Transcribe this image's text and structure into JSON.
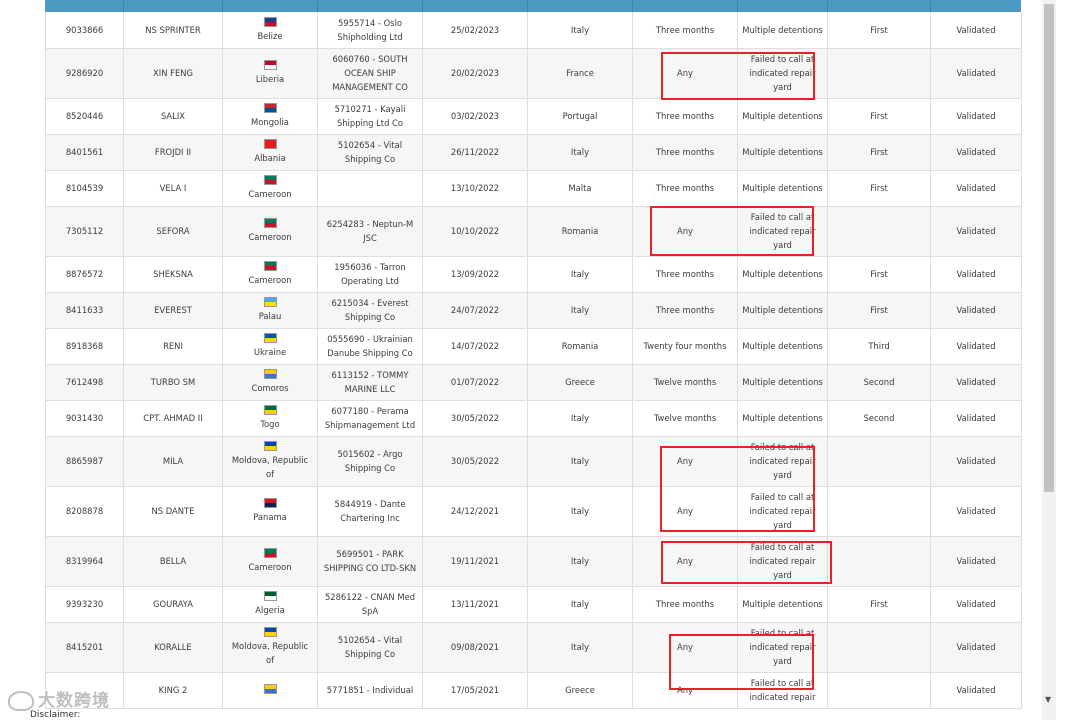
{
  "rows": [
    {
      "imo": "9033866",
      "name": "NS SPRINTER",
      "flag": "Belize",
      "flag_colors": [
        "#1c3f94",
        "#c8102e"
      ],
      "company": "5955714 - Oslo Shipholding Ltd",
      "date": "25/02/2023",
      "location": "Italy",
      "duration": "Three months",
      "reason": "Multiple detentions",
      "level": "First",
      "status": "Validated"
    },
    {
      "imo": "9286920",
      "name": "XIN FENG",
      "flag": "Liberia",
      "flag_colors": [
        "#bf0a30",
        "#ffffff"
      ],
      "company": "6060760 - SOUTH OCEAN SHIP MANAGEMENT CO",
      "date": "20/02/2023",
      "location": "France",
      "duration": "Any",
      "reason": "Failed to call at indicated repair yard",
      "level": "",
      "status": "Validated"
    },
    {
      "imo": "8520446",
      "name": "SALIX",
      "flag": "Mongolia",
      "flag_colors": [
        "#c4272f",
        "#015197"
      ],
      "company": "5710271 - Kayali Shipping Ltd Co",
      "date": "03/02/2023",
      "location": "Portugal",
      "duration": "Three months",
      "reason": "Multiple detentions",
      "level": "First",
      "status": "Validated"
    },
    {
      "imo": "8401561",
      "name": "FROJDI II",
      "flag": "Albania",
      "flag_colors": [
        "#e41e20",
        "#e41e20"
      ],
      "company": "5102654 - Vital Shipping Co",
      "date": "26/11/2022",
      "location": "Italy",
      "duration": "Three months",
      "reason": "Multiple detentions",
      "level": "First",
      "status": "Validated"
    },
    {
      "imo": "8104539",
      "name": "VELA I",
      "flag": "Cameroon",
      "flag_colors": [
        "#007a5e",
        "#ce1126"
      ],
      "company": "",
      "date": "13/10/2022",
      "location": "Malta",
      "duration": "Three months",
      "reason": "Multiple detentions",
      "level": "First",
      "status": "Validated"
    },
    {
      "imo": "7305112",
      "name": "SEFORA",
      "flag": "Cameroon",
      "flag_colors": [
        "#007a5e",
        "#ce1126"
      ],
      "company": "6254283 - Neptun-M JSC",
      "date": "10/10/2022",
      "location": "Romania",
      "duration": "Any",
      "reason": "Failed to call at indicated repair yard",
      "level": "",
      "status": "Validated"
    },
    {
      "imo": "8876572",
      "name": "SHEKSNA",
      "flag": "Cameroon",
      "flag_colors": [
        "#007a5e",
        "#ce1126"
      ],
      "company": "1956036 - Tarron Operating Ltd",
      "date": "13/09/2022",
      "location": "Italy",
      "duration": "Three months",
      "reason": "Multiple detentions",
      "level": "First",
      "status": "Validated"
    },
    {
      "imo": "8411633",
      "name": "EVEREST",
      "flag": "Palau",
      "flag_colors": [
        "#4aadd6",
        "#ffde00"
      ],
      "company": "6215034 - Everest Shipping Co",
      "date": "24/07/2022",
      "location": "Italy",
      "duration": "Three months",
      "reason": "Multiple detentions",
      "level": "First",
      "status": "Validated"
    },
    {
      "imo": "8918368",
      "name": "RENI",
      "flag": "Ukraine",
      "flag_colors": [
        "#0057b7",
        "#ffd700"
      ],
      "company": "0555690 - Ukrainian Danube Shipping Co",
      "date": "14/07/2022",
      "location": "Romania",
      "duration": "Twenty four months",
      "reason": "Multiple detentions",
      "level": "Third",
      "status": "Validated"
    },
    {
      "imo": "7612498",
      "name": "TURBO SM",
      "flag": "Comoros",
      "flag_colors": [
        "#ffc61e",
        "#3a75c4"
      ],
      "company": "6113152 - TOMMY MARINE LLC",
      "date": "01/07/2022",
      "location": "Greece",
      "duration": "Twelve months",
      "reason": "Multiple detentions",
      "level": "Second",
      "status": "Validated"
    },
    {
      "imo": "9031430",
      "name": "CPT. AHMAD II",
      "flag": "Togo",
      "flag_colors": [
        "#006a4e",
        "#ffce00"
      ],
      "company": "6077180 - Perama Shipmanagement Ltd",
      "date": "30/05/2022",
      "location": "Italy",
      "duration": "Twelve months",
      "reason": "Multiple detentions",
      "level": "Second",
      "status": "Validated"
    },
    {
      "imo": "8865987",
      "name": "MILA",
      "flag": "Moldova, Republic of",
      "flag_colors": [
        "#0046ae",
        "#ffd200"
      ],
      "company": "5015602 - Argo Shipping Co",
      "date": "30/05/2022",
      "location": "Italy",
      "duration": "Any",
      "reason": "Failed to call at indicated repair yard",
      "level": "",
      "status": "Validated"
    },
    {
      "imo": "8208878",
      "name": "NS DANTE",
      "flag": "Panama",
      "flag_colors": [
        "#da121a",
        "#072357"
      ],
      "company": "5844919 - Dante Chartering Inc",
      "date": "24/12/2021",
      "location": "Italy",
      "duration": "Any",
      "reason": "Failed to call at indicated repair yard",
      "level": "",
      "status": "Validated"
    },
    {
      "imo": "8319964",
      "name": "BELLA",
      "flag": "Cameroon",
      "flag_colors": [
        "#007a5e",
        "#ce1126"
      ],
      "company": "5699501 - PARK SHIPPING CO LTD-SKN",
      "date": "19/11/2021",
      "location": "Italy",
      "duration": "Any",
      "reason": "Failed to call at indicated repair yard",
      "level": "",
      "status": "Validated"
    },
    {
      "imo": "9393230",
      "name": "GOURAYA",
      "flag": "Algeria",
      "flag_colors": [
        "#006233",
        "#ffffff"
      ],
      "company": "5286122 - CNAN Med SpA",
      "date": "13/11/2021",
      "location": "Italy",
      "duration": "Three months",
      "reason": "Multiple detentions",
      "level": "First",
      "status": "Validated"
    },
    {
      "imo": "8415201",
      "name": "KORALLE",
      "flag": "Moldova, Republic of",
      "flag_colors": [
        "#0046ae",
        "#ffd200"
      ],
      "company": "5102654 - Vital Shipping Co",
      "date": "09/08/2021",
      "location": "Italy",
      "duration": "Any",
      "reason": "Failed to call at indicated repair yard",
      "level": "",
      "status": "Validated"
    },
    {
      "imo": "",
      "name": "KING 2",
      "flag": "",
      "flag_colors": [
        "#ffc61e",
        "#3a75c4"
      ],
      "company": "5771851 - Individual",
      "date": "17/05/2021",
      "location": "Greece",
      "duration": "Any",
      "reason": "Failed to call at indicated repair",
      "level": "",
      "status": "Validated"
    }
  ],
  "footer": {
    "disclaimer": "Disclaimer:"
  },
  "watermark": {
    "text": "大数跨境"
  },
  "colors": {
    "header": "#4a9ac4",
    "highlight": "#e8212b",
    "row_alt": "#f6f6f6"
  }
}
